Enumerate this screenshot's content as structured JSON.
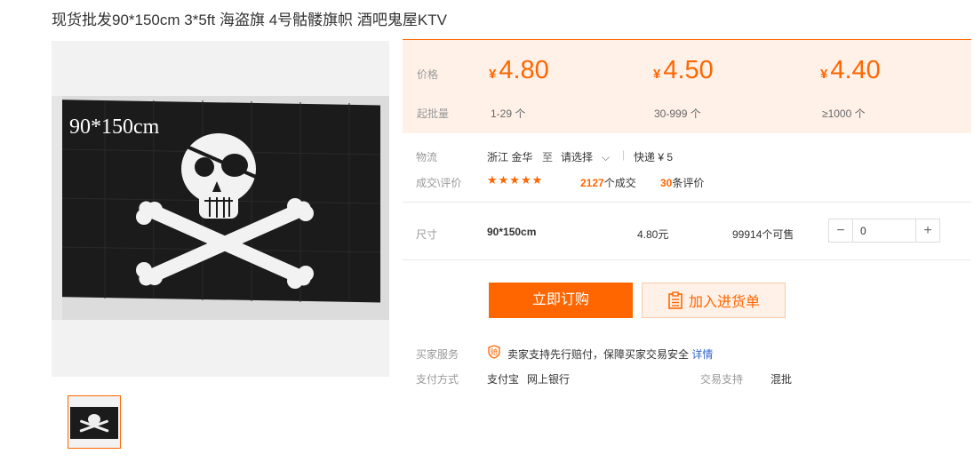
{
  "product": {
    "title": "现货批发90*150cm 3*5ft 海盗旗 4号骷髅旗帜 酒吧鬼屋KTV",
    "image_caption": "90*150cm"
  },
  "price_band": {
    "price_label": "价格",
    "moq_label": "起批量",
    "currency": "¥",
    "tiers": [
      {
        "price": "4.80",
        "range": "1-29 个"
      },
      {
        "price": "4.50",
        "range": "30-999 个"
      },
      {
        "price": "4.40",
        "range": "≥1000 个"
      }
    ]
  },
  "logistics": {
    "label": "物流",
    "origin": "浙江 金华",
    "to": "至",
    "destination": "请选择",
    "express": "快递 ¥ 5"
  },
  "reviews": {
    "label": "成交\\评价",
    "stars": "★★★★★",
    "rating": 5,
    "deals_count": "2127",
    "deals_suffix": "个成交",
    "reviews_count": "30",
    "reviews_suffix": "条评价"
  },
  "sku": {
    "label": "尺寸",
    "size": "90*150cm",
    "price": "4.80元",
    "stock": "99914个可售",
    "quantity": "0",
    "minus": "−",
    "plus": "+"
  },
  "actions": {
    "buy": "立即订购",
    "cart": "加入进货单"
  },
  "services": {
    "buyer_label": "买家服务",
    "guarantee_text": "卖家支持先行赔付，保障买家交易安全",
    "details_link": "详情",
    "payment_label": "支付方式",
    "payment_alipay": "支付宝",
    "payment_bank": "网上银行",
    "trade_label": "交易支持",
    "trade_value": "混批"
  },
  "colors": {
    "accent": "#ff6600",
    "band": "#fff1e8",
    "link": "#3366cc"
  },
  "icons": [
    "guarantee-icon",
    "cart-list-icon",
    "chevron-down-icon",
    "skull-crossbones-flag"
  ]
}
